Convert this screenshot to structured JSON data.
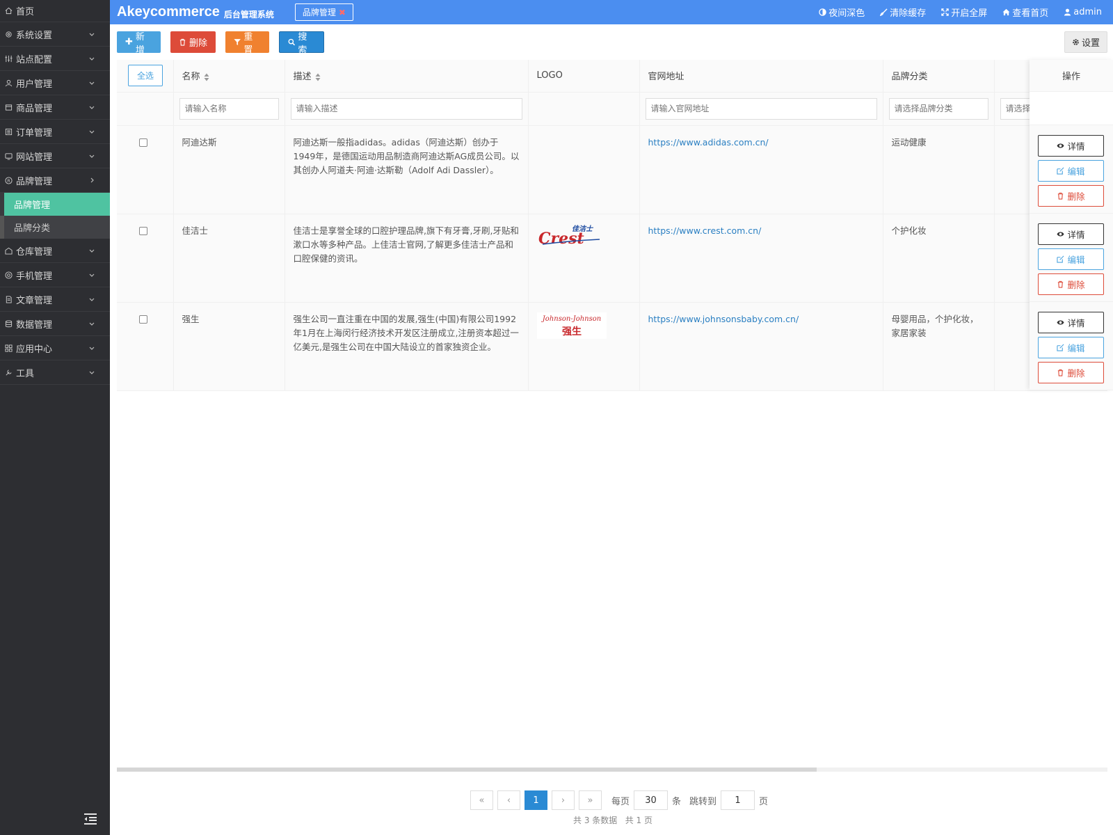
{
  "sidebar": {
    "items": [
      {
        "label": "首页",
        "icon": "home-icon"
      },
      {
        "label": "系统设置",
        "icon": "gear-icon"
      },
      {
        "label": "站点配置",
        "icon": "sliders-icon"
      },
      {
        "label": "用户管理",
        "icon": "user-icon"
      },
      {
        "label": "商品管理",
        "icon": "box-icon"
      },
      {
        "label": "订单管理",
        "icon": "list-icon"
      },
      {
        "label": "网站管理",
        "icon": "globe-icon"
      },
      {
        "label": "品牌管理",
        "icon": "registered-icon"
      },
      {
        "label": "仓库管理",
        "icon": "warehouse-icon"
      },
      {
        "label": "手机管理",
        "icon": "phone-icon"
      },
      {
        "label": "文章管理",
        "icon": "document-icon"
      },
      {
        "label": "数据管理",
        "icon": "database-icon"
      },
      {
        "label": "应用中心",
        "icon": "grid-icon"
      },
      {
        "label": "工具",
        "icon": "tools-icon"
      }
    ],
    "brand_sub": [
      "品牌管理",
      "品牌分类"
    ]
  },
  "header": {
    "brand": "Akeycommerce",
    "brand_sub": "后台管理系统",
    "tab": "品牌管理",
    "links": [
      "夜间深色",
      "清除缓存",
      "开启全屏",
      "查看首页",
      "admin"
    ]
  },
  "toolbar": {
    "add": "新增",
    "delete": "删除",
    "reset": "重置",
    "search": "搜索",
    "settings": "设置"
  },
  "table": {
    "select_all": "全选",
    "columns": [
      "名称",
      "描述",
      "LOGO",
      "官网地址",
      "品牌分类"
    ],
    "op_header": "操作",
    "placeholders": {
      "name": "请输入名称",
      "desc": "请输入描述",
      "url": "请输入官网地址",
      "category": "请选择品牌分类",
      "extra": "请选择"
    },
    "rows": [
      {
        "name": "阿迪达斯",
        "desc": "阿迪达斯一般指adidas。adidas（阿迪达斯）创办于1949年，是德国运动用品制造商阿迪达斯AG成员公司。以其创办人阿道夫·阿迪·达斯勒（Adolf Adi Dassler）。",
        "logo": "",
        "url": "https://www.adidas.com.cn/",
        "category": "运动健康"
      },
      {
        "name": "佳洁士",
        "desc": "佳洁士是享誉全球的口腔护理品牌,旗下有牙膏,牙刷,牙贴和漱口水等多种产品。上佳洁士官网,了解更多佳洁士产品和口腔保健的资讯。",
        "logo": "Crest",
        "logo_top": "佳洁士",
        "url": "https://www.crest.com.cn/",
        "category": "个护化妆"
      },
      {
        "name": "强生",
        "desc": "强生公司一直注重在中国的发展,强生(中国)有限公司1992年1月在上海闵行经济技术开发区注册成立,注册资本超过一亿美元,是强生公司在中国大陆设立的首家独资企业。",
        "logo": "Johnson-Johnson",
        "logo_top": "强生",
        "url": "https://www.johnsonsbaby.com.cn/",
        "category": "母婴用品，个护化妆，家居家装"
      }
    ],
    "ops": {
      "detail": "详情",
      "edit": "编辑",
      "delete": "删除"
    }
  },
  "pagination": {
    "first": "«",
    "prev": "‹",
    "current": "1",
    "next": "›",
    "last": "»",
    "per_page_label": "每页",
    "per_page": "30",
    "unit": "条",
    "jump_label": "跳转到",
    "jump_page": "1",
    "page_unit": "页",
    "summary": "共 3 条数据   共 1 页"
  },
  "colors": {
    "header": "#4b8ef0",
    "sidebar": "#2d2e32",
    "active": "#4fc3a1",
    "primary": "#2a8ad4",
    "danger": "#dd4b39",
    "warning": "#f0812f"
  }
}
